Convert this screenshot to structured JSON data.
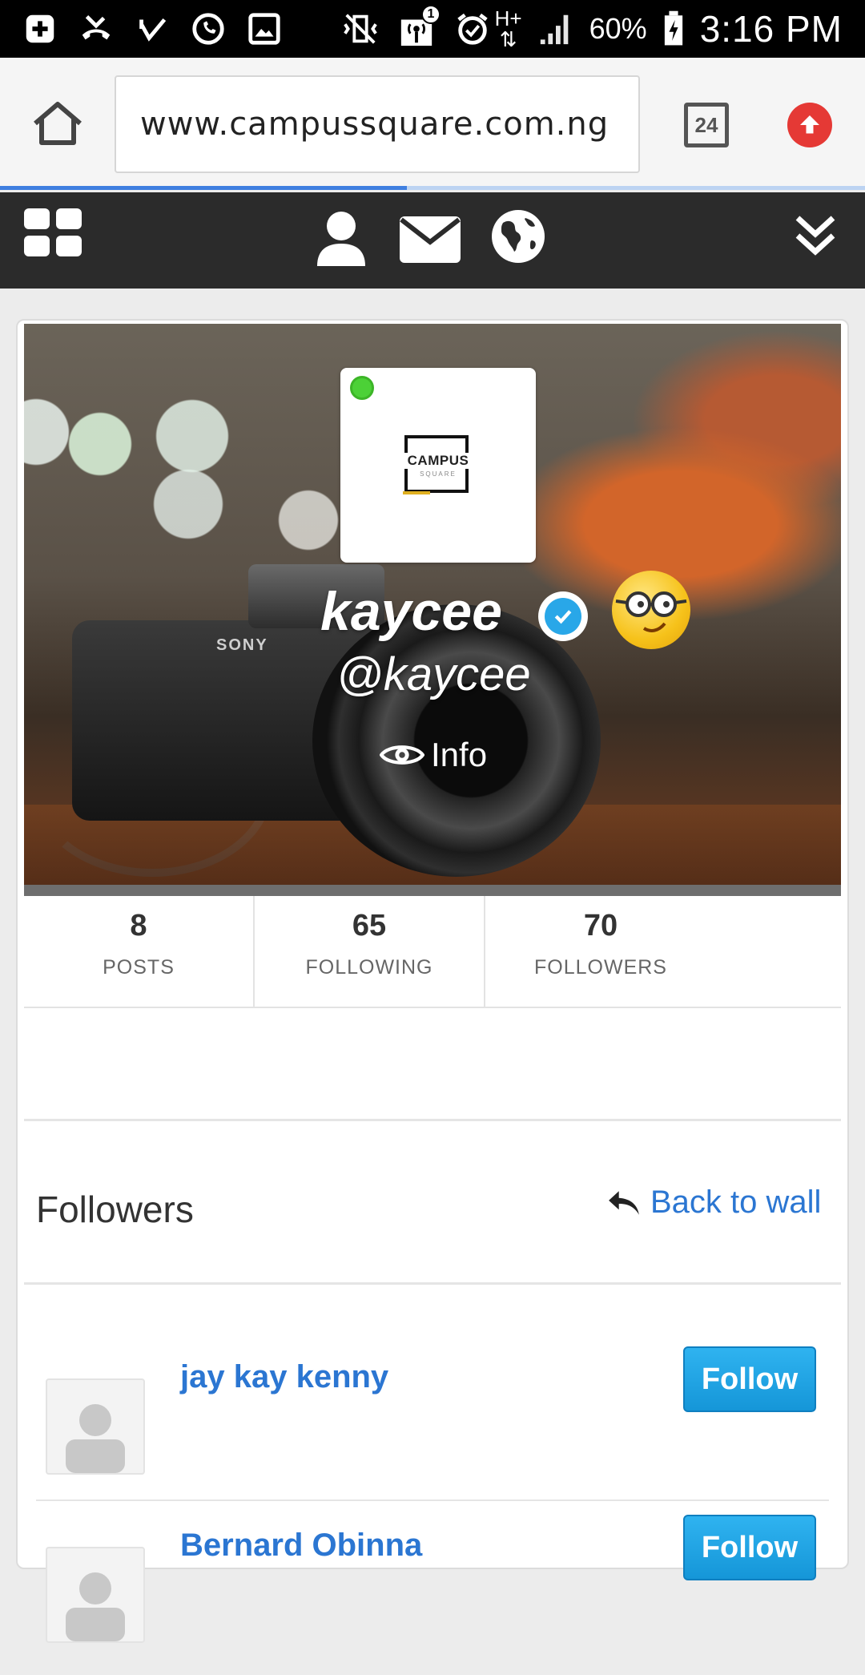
{
  "status_bar": {
    "battery": "60%",
    "time": "3:16 PM",
    "notification_badge": "1",
    "icons": [
      "add-box-icon",
      "missed-call-icon",
      "check-icon",
      "whatsapp-icon",
      "image-icon",
      "vibrate-icon",
      "hotspot-icon",
      "alarm-icon",
      "network-hplus-icon",
      "signal-icon",
      "battery-icon"
    ],
    "network_label": "H+"
  },
  "browser": {
    "url": "www.campussquare.com.ng",
    "tab_count": "24",
    "load_progress": 0.47,
    "accent_color": "#e53935"
  },
  "navbar": {
    "icons": [
      "grid-menu-icon",
      "user-icon",
      "envelope-icon",
      "globe-icon",
      "double-chevron-down-icon"
    ]
  },
  "profile": {
    "avatar_logo_text": "CAMPUS",
    "avatar_logo_subtext": "SQUARE",
    "name": "kaycee",
    "handle": "@kaycee",
    "info_label": "Info",
    "online": true,
    "verified": true,
    "cover_brand_text": "SONY"
  },
  "stats": [
    {
      "value": "8",
      "label": "POSTS"
    },
    {
      "value": "65",
      "label": "FOLLOWING"
    },
    {
      "value": "70",
      "label": "FOLLOWERS"
    }
  ],
  "followers_section": {
    "title": "Followers",
    "back_label": "Back to wall",
    "items": [
      {
        "name": "jay kay kenny",
        "button": "Follow"
      },
      {
        "name": "Bernard Obinna",
        "button": "Follow"
      }
    ]
  },
  "colors": {
    "link": "#2b76d2",
    "follow_button": "#1596d8",
    "navbar": "#2b2b2b",
    "online": "#4cd137",
    "verified": "#29a7e8"
  }
}
